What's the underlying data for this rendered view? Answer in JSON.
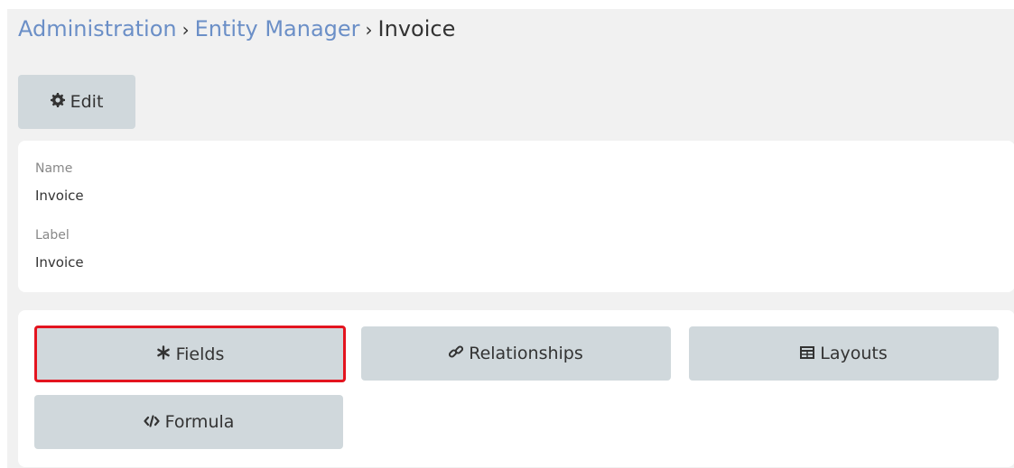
{
  "breadcrumb": {
    "items": [
      "Administration",
      "Entity Manager"
    ],
    "current": "Invoice",
    "separator": "›"
  },
  "toolbar": {
    "edit_label": "Edit",
    "edit_icon": "gear-icon"
  },
  "details": {
    "name_label": "Name",
    "name_value": "Invoice",
    "label_label": "Label",
    "label_value": "Invoice"
  },
  "actions": {
    "fields": {
      "label": "Fields",
      "icon": "asterisk-icon"
    },
    "relationships": {
      "label": "Relationships",
      "icon": "link-icon"
    },
    "layouts": {
      "label": "Layouts",
      "icon": "table-icon"
    },
    "formula": {
      "label": "Formula",
      "icon": "code-icon"
    }
  },
  "colors": {
    "link": "#6b8fc7",
    "button_bg": "#d0d8dc",
    "highlight": "#e3141f",
    "page_bg": "#f1f1f1"
  }
}
